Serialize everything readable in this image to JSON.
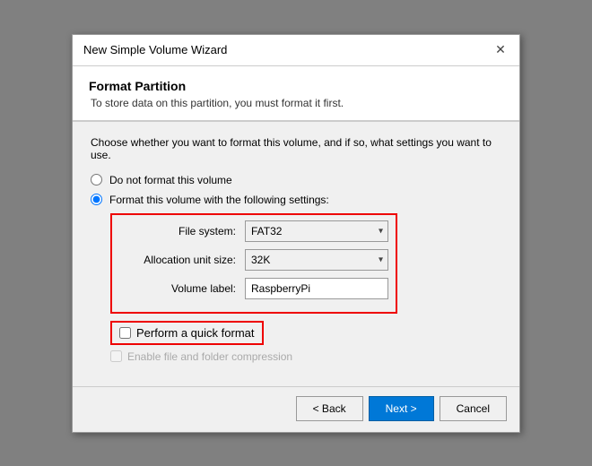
{
  "dialog": {
    "title": "New Simple Volume Wizard",
    "close_label": "✕"
  },
  "header": {
    "title": "Format Partition",
    "subtitle": "To store data on this partition, you must format it first."
  },
  "content": {
    "description": "Choose whether you want to format this volume, and if so, what settings you want to use.",
    "radio_no_format": "Do not format this volume",
    "radio_format": "Format this volume with the following settings:",
    "file_system_label": "File system:",
    "file_system_value": "FAT32",
    "allocation_label": "Allocation unit size:",
    "allocation_value": "32K",
    "volume_label": "Volume label:",
    "volume_value": "RaspberryPi",
    "quick_format_label": "Perform a quick format",
    "compression_label": "Enable file and folder compression"
  },
  "footer": {
    "back_label": "< Back",
    "next_label": "Next >",
    "cancel_label": "Cancel"
  }
}
